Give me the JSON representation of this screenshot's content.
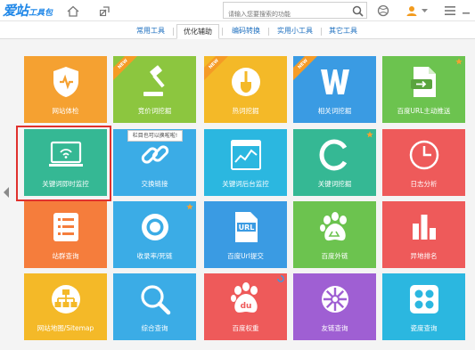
{
  "app": {
    "logo_main": "爱站",
    "logo_sub": "工具包"
  },
  "search": {
    "placeholder": "请输入您要搜索的功能"
  },
  "tabs": [
    {
      "label": "常用工具",
      "active": false
    },
    {
      "label": "优化辅助",
      "active": true
    },
    {
      "label": "编码转换",
      "active": false
    },
    {
      "label": "实用小工具",
      "active": false
    },
    {
      "label": "其它工具",
      "active": false
    }
  ],
  "tooltip": "栏目也可以换啦啦!",
  "badges": {
    "new": "NEW"
  },
  "colors": {
    "orange": "#f5a131",
    "green": "#8cc63f",
    "yellow": "#f4b928",
    "blue": "#3a9be3",
    "lightgreen": "#6cc34f",
    "teal": "#35b894",
    "sky": "#3bace6",
    "red": "#ee5a5a",
    "purple": "#9f5fd3",
    "cyan": "#2bb7e0",
    "selected": "#e0312d"
  },
  "tiles": [
    {
      "label": "网站体检",
      "icon": "shield-check-icon",
      "color": "#f5a131",
      "badge": ""
    },
    {
      "label": "竞价词挖掘",
      "icon": "gavel-icon",
      "color": "#8cc63f",
      "badge": "new"
    },
    {
      "label": "热词挖掘",
      "icon": "shovel-icon",
      "color": "#f4b928",
      "badge": "new"
    },
    {
      "label": "相关词挖掘",
      "icon": "w-letter-icon",
      "color": "#3a9be3",
      "badge": "new"
    },
    {
      "label": "百度URL主动推送",
      "icon": "document-push-icon",
      "color": "#6cc34f",
      "badge": "star"
    },
    {
      "label": "关键词即时监控",
      "icon": "monitor-icon",
      "color": "#35b894",
      "badge": ""
    },
    {
      "label": "交换链接",
      "icon": "link-icon",
      "color": "#3bace6",
      "badge": ""
    },
    {
      "label": "关键词后台监控",
      "icon": "chart-screen-icon",
      "color": "#2bb7e0",
      "badge": ""
    },
    {
      "label": "关键词挖掘",
      "icon": "c-letter-icon",
      "color": "#35b894",
      "badge": "star"
    },
    {
      "label": "日志分析",
      "icon": "clock-icon",
      "color": "#ee5a5a",
      "badge": ""
    },
    {
      "label": "站群查询",
      "icon": "list-icon",
      "color": "#f57d3c",
      "badge": ""
    },
    {
      "label": "收录率/死链",
      "icon": "ring-icon",
      "color": "#3bace6",
      "badge": "star"
    },
    {
      "label": "百度Url提交",
      "icon": "url-doc-icon",
      "color": "#3a9be3",
      "badge": ""
    },
    {
      "label": "百度外链",
      "icon": "baidu-paw-icon",
      "color": "#6cc34f",
      "badge": ""
    },
    {
      "label": "异地排名",
      "icon": "bar-rank-icon",
      "color": "#ee5a5a",
      "badge": ""
    },
    {
      "label": "网站地图/Sitemap",
      "icon": "sitemap-icon",
      "color": "#f4b928",
      "badge": ""
    },
    {
      "label": "综合查询",
      "icon": "magnifier-icon",
      "color": "#3bace6",
      "badge": ""
    },
    {
      "label": "百度权重",
      "icon": "baidu-du-icon",
      "color": "#ee5a5a",
      "badge": "loading"
    },
    {
      "label": "友链查询",
      "icon": "wheel-icon",
      "color": "#9f5fd3",
      "badge": ""
    },
    {
      "label": "瓷度查询",
      "icon": "tiles-icon",
      "color": "#2bb7e0",
      "badge": ""
    }
  ]
}
